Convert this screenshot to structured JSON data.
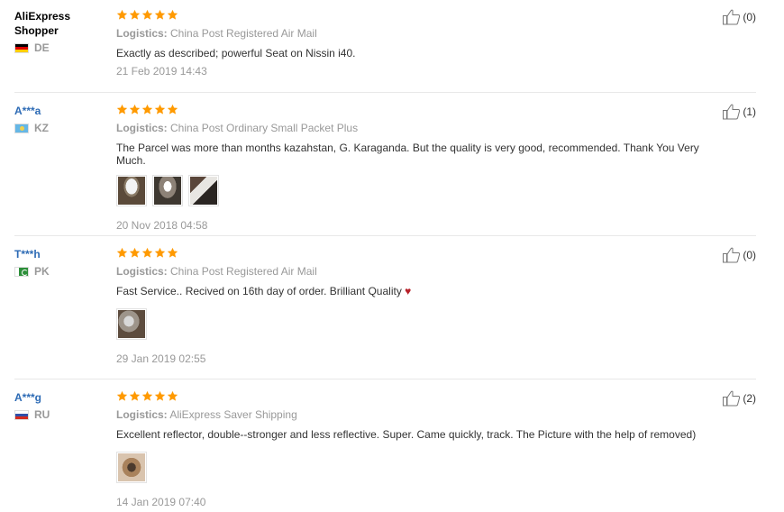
{
  "colors": {
    "star": "#ff9a00",
    "username_link": "#2d6bb5",
    "heart": "#b8212a"
  },
  "logistics_label": "Logistics:",
  "reviews": [
    {
      "user": "AliExpress Shopper",
      "user_line1": "AliExpress",
      "user_line2": "Shopper",
      "country": "DE",
      "flag_icon": "germany-flag-icon",
      "stars": 5,
      "logistics": "China Post Registered Air Mail",
      "text": "Exactly as described; powerful Seat on Nissin i40.",
      "photos": [],
      "date": "21 Feb 2019 14:43",
      "helpful": "(0)"
    },
    {
      "user": "A***a",
      "country": "KZ",
      "flag_icon": "kazakhstan-flag-icon",
      "stars": 5,
      "logistics": "China Post Ordinary Small Packet Plus",
      "text": "The Parcel was more than months kazahstan, G. Karaganda. But the quality is very good, recommended. Thank You Very Much.",
      "photos": [
        "review-photo",
        "review-photo",
        "review-photo"
      ],
      "date": "20 Nov 2018 04:58",
      "helpful": "(1)"
    },
    {
      "user": "T***h",
      "country": "PK",
      "flag_icon": "pakistan-flag-icon",
      "stars": 5,
      "logistics": "China Post Registered Air Mail",
      "text": "Fast Service.. Recived on 16th day of order. Brilliant Quality",
      "text_suffix": "♥",
      "photos": [
        "review-photo"
      ],
      "date": "29 Jan 2019 02:55",
      "helpful": "(0)"
    },
    {
      "user": "A***g",
      "country": "RU",
      "flag_icon": "russia-flag-icon",
      "stars": 5,
      "logistics": "AliExpress Saver Shipping",
      "text": "Excellent reflector, double--stronger and less reflective. Super. Came quickly, track. The Picture with the help of removed)",
      "photos": [
        "review-photo"
      ],
      "date": "14 Jan 2019 07:40",
      "helpful": "(2)"
    }
  ]
}
